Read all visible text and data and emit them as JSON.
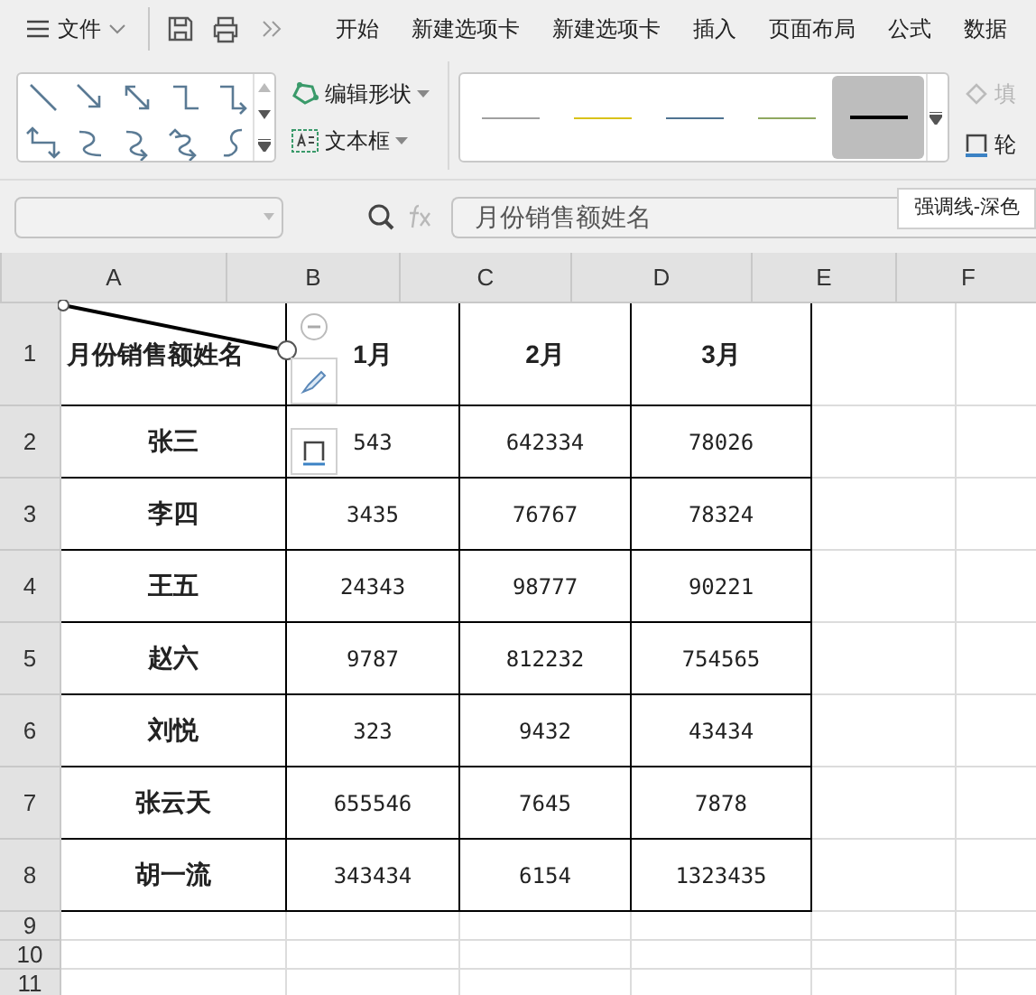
{
  "menu": {
    "label": "文件"
  },
  "tabs": [
    "开始",
    "新建选项卡",
    "新建选项卡",
    "插入",
    "页面布局",
    "公式",
    "数据"
  ],
  "ribbon": {
    "shape_tools": [
      {
        "kind": "edit",
        "label": "编辑形状"
      },
      {
        "kind": "textbox",
        "label": "文本框"
      }
    ],
    "line_styles": [
      {
        "color": "#a0a0a0",
        "selected": false
      },
      {
        "color": "#d9c21a",
        "selected": false
      },
      {
        "color": "#4f7391",
        "selected": false
      },
      {
        "color": "#8fa860",
        "selected": false
      },
      {
        "color": "#000000",
        "selected": true
      }
    ],
    "fill": {
      "label": "填",
      "disabled": true
    },
    "outline": {
      "label": "轮"
    }
  },
  "formula_bar": {
    "value": "月份销售额姓名",
    "tooltip": "强调线-深色"
  },
  "columns": [
    "A",
    "B",
    "C",
    "D",
    "E",
    "F"
  ],
  "rows": [
    {
      "number": "1",
      "cells": [
        "月份销售额姓名",
        "1月",
        "2月",
        "3月"
      ]
    },
    {
      "number": "2",
      "cells": [
        "张三",
        "543",
        "642334",
        "78026"
      ]
    },
    {
      "number": "3",
      "cells": [
        "李四",
        "3435",
        "76767",
        "78324"
      ]
    },
    {
      "number": "4",
      "cells": [
        "王五",
        "24343",
        "98777",
        "90221"
      ]
    },
    {
      "number": "5",
      "cells": [
        "赵六",
        "9787",
        "812232",
        "754565"
      ]
    },
    {
      "number": "6",
      "cells": [
        "刘悦",
        "323",
        "9432",
        "43434"
      ]
    },
    {
      "number": "7",
      "cells": [
        "张云天",
        "655546",
        "7645",
        "7878"
      ]
    },
    {
      "number": "8",
      "cells": [
        "胡一流",
        "343434",
        "6154",
        "1323435"
      ]
    },
    {
      "number": "9",
      "cells": []
    },
    {
      "number": "10",
      "cells": []
    },
    {
      "number": "11",
      "cells": []
    }
  ]
}
